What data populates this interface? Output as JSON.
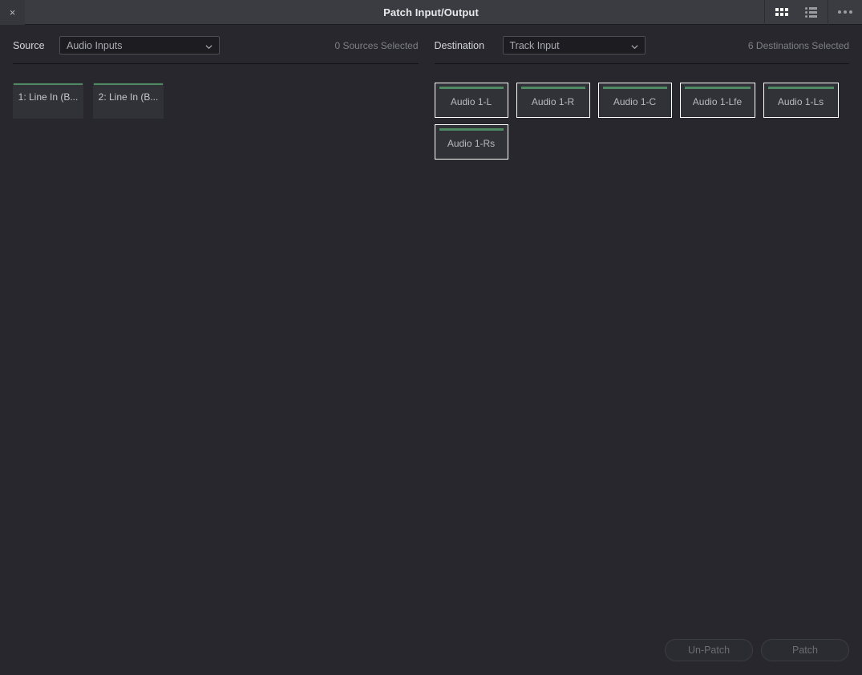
{
  "window": {
    "title": "Patch Input/Output",
    "close_label": "×",
    "view_grid_icon": "grid-view-icon",
    "view_list_icon": "list-view-icon",
    "overflow_icon": "more-options-icon"
  },
  "source": {
    "label": "Source",
    "select_value": "Audio Inputs",
    "chevron_icon": "chevron-down-icon",
    "selected_count": "0 Sources Selected",
    "tiles": [
      {
        "label": "1: Line In (B...",
        "selected": false
      },
      {
        "label": "2: Line In (B...",
        "selected": false
      }
    ]
  },
  "destination": {
    "label": "Destination",
    "select_value": "Track Input",
    "chevron_icon": "chevron-down-icon",
    "selected_count": "6 Destinations Selected",
    "tiles": [
      {
        "label": "Audio 1-L",
        "selected": true
      },
      {
        "label": "Audio 1-R",
        "selected": true
      },
      {
        "label": "Audio 1-C",
        "selected": true
      },
      {
        "label": "Audio 1-Lfe",
        "selected": true
      },
      {
        "label": "Audio 1-Ls",
        "selected": true
      },
      {
        "label": "Audio 1-Rs",
        "selected": true
      }
    ]
  },
  "footer": {
    "unpatch_label": "Un-Patch",
    "patch_label": "Patch"
  },
  "colors": {
    "window_background": "#27272d",
    "titlebar_background": "#3a3c42",
    "tile_background": "#313238",
    "accent_green": "#4f8b62",
    "selected_outline": "#ffffff",
    "text_primary": "#e8e9eb",
    "text_secondary": "#a8aab0",
    "text_muted": "#7e8086",
    "disabled_text": "#6b6d74"
  }
}
